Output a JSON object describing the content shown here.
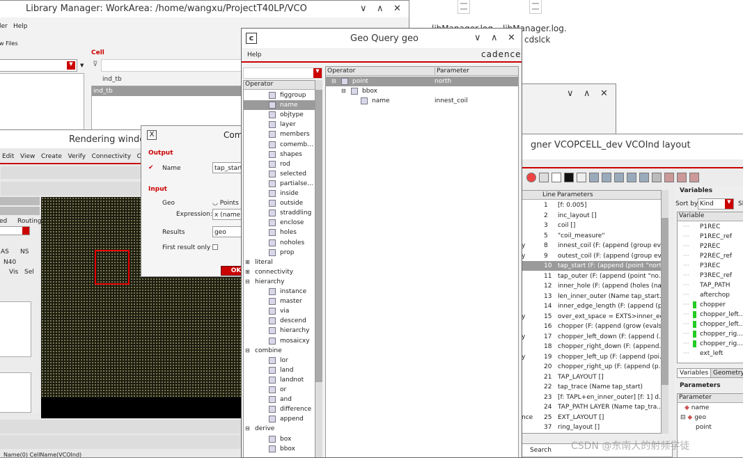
{
  "desktop": {
    "files": [
      {
        "label": "libManager.log"
      },
      {
        "label": "libManager.log."
      },
      {
        "label": "cdslck"
      }
    ]
  },
  "lib_manager": {
    "title": "Library Manager: WorkArea: /home/wangxu/ProjectT40LP/VCO",
    "menu": [
      "ler",
      "Help"
    ],
    "show_files": "w Files",
    "cell_label": "Cell",
    "cell_filter": "ind_tb",
    "cell_items": [
      "ind_tb"
    ]
  },
  "geo_query": {
    "title": "Geo Query geo",
    "menu": "Help",
    "brand": "cadence",
    "operator_header": "Operator",
    "columns": [
      "Operator",
      "Parameter"
    ],
    "operators": [
      {
        "label": "figgroup",
        "indent": 1
      },
      {
        "label": "name",
        "indent": 1,
        "selected": true
      },
      {
        "label": "objtype",
        "indent": 1
      },
      {
        "label": "layer",
        "indent": 1
      },
      {
        "label": "members",
        "indent": 1
      },
      {
        "label": "comemb...",
        "indent": 1
      },
      {
        "label": "shapes",
        "indent": 1
      },
      {
        "label": "rod",
        "indent": 1
      },
      {
        "label": "selected",
        "indent": 1
      },
      {
        "label": "partialse...",
        "indent": 1
      },
      {
        "label": "inside",
        "indent": 1
      },
      {
        "label": "outside",
        "indent": 1
      },
      {
        "label": "straddling",
        "indent": 1
      },
      {
        "label": "enclose",
        "indent": 1
      },
      {
        "label": "holes",
        "indent": 1
      },
      {
        "label": "noholes",
        "indent": 1
      },
      {
        "label": "prop",
        "indent": 1
      },
      {
        "label": "literal",
        "indent": 0,
        "expander": "+"
      },
      {
        "label": "connectivity",
        "indent": 0,
        "expander": "+"
      },
      {
        "label": "hierarchy",
        "indent": 0,
        "expander": "-"
      },
      {
        "label": "instance",
        "indent": 1
      },
      {
        "label": "master",
        "indent": 1
      },
      {
        "label": "via",
        "indent": 1
      },
      {
        "label": "descend",
        "indent": 1
      },
      {
        "label": "hierarchy",
        "indent": 1
      },
      {
        "label": "mosaicxy",
        "indent": 1
      },
      {
        "label": "combine",
        "indent": 0,
        "expander": "-"
      },
      {
        "label": "lor",
        "indent": 1
      },
      {
        "label": "land",
        "indent": 1
      },
      {
        "label": "landnot",
        "indent": 1
      },
      {
        "label": "or",
        "indent": 1
      },
      {
        "label": "and",
        "indent": 1
      },
      {
        "label": "difference",
        "indent": 1
      },
      {
        "label": "append",
        "indent": 1
      },
      {
        "label": "derive",
        "indent": 0,
        "expander": "-"
      },
      {
        "label": "box",
        "indent": 1
      },
      {
        "label": "bbox",
        "indent": 1
      }
    ],
    "query_tree": [
      {
        "op": "point",
        "param": "north",
        "level": 0,
        "selected": true
      },
      {
        "op": "bbox",
        "param": "",
        "level": 1
      },
      {
        "op": "name",
        "param": "innest_coil",
        "level": 2
      }
    ]
  },
  "ghost_window": {
    "title": ""
  },
  "rendering": {
    "title": "Rendering window",
    "menu": [
      "Edit",
      "View",
      "Create",
      "Verify",
      "Connectivity",
      "Opt"
    ],
    "routing": "Routing",
    "ed": "ed",
    "as": "AS",
    "ns": "NS",
    "layer_title": "N40",
    "vis": "Vis",
    "sel": "Sel",
    "status": "Name(0)   CellName(VCOInd)"
  },
  "com_dialog": {
    "title": "Com",
    "output_label": "Output",
    "name_label": "Name",
    "name_value": "tap_start",
    "input_label": "Input",
    "geo_label": "Geo",
    "points_label": "Points",
    "expression_label": "Expression:",
    "expression_value": "x (name",
    "results_label": "Results",
    "results_value": "geo",
    "first_result_label": "First result only",
    "ok_label": "OK"
  },
  "designer": {
    "title": "gner VCOPCELL_dev VCOInd layout",
    "headers": {
      "line": "Line",
      "params": "Parameters"
    },
    "left_marks": [
      "",
      "",
      "",
      "",
      "y",
      "y",
      "",
      "",
      "",
      "",
      "",
      "y",
      "",
      "y",
      "",
      "y",
      "",
      "",
      "",
      "",
      "",
      "nce",
      "",
      "",
      ""
    ],
    "rows": [
      {
        "line": "1",
        "text": "[f: 0.005]"
      },
      {
        "line": "2",
        "text": "inc_layout []"
      },
      {
        "line": "3",
        "text": "coil []"
      },
      {
        "line": "5",
        "text": "\"coil_measure\""
      },
      {
        "line": "8",
        "text": "innest_coil (F: (append (group ev..."
      },
      {
        "line": "9",
        "text": "outest_coil (F: (append (group ev..."
      },
      {
        "line": "10",
        "text": "tap_start (F: (append (point \"nort...",
        "selected": true
      },
      {
        "line": "11",
        "text": "tap_outer (F: (append (point \"no..."
      },
      {
        "line": "12",
        "text": "inner_hole (F: (append (holes (na..."
      },
      {
        "line": "13",
        "text": "len_inner_outer (Name tap_start..."
      },
      {
        "line": "14",
        "text": "inner_edge_length (F: (append (p..."
      },
      {
        "line": "15",
        "text": "over_ext_space = EXTS>inner_ed..."
      },
      {
        "line": "16",
        "text": "chopper (F: (append (grow (evals..."
      },
      {
        "line": "17",
        "text": "chopper_left_down (F: (append (..."
      },
      {
        "line": "18",
        "text": "chopper_right_down (F: (append..."
      },
      {
        "line": "19",
        "text": "chopper_left_up (F: (append (poi..."
      },
      {
        "line": "20",
        "text": "chopper_right_up (F: (append (p..."
      },
      {
        "line": "21",
        "text": "TAP_LAYOUT []"
      },
      {
        "line": "22",
        "text": "tap_trace (Name tap_start)"
      },
      {
        "line": "23",
        "text": "[f: TAPL+en_inner_outer] [f: 1] d..."
      },
      {
        "line": "24",
        "text": "TAP_PATH LAYER (Name tap_tra..."
      },
      {
        "line": "25",
        "text": "EXT_LAYOUT []"
      },
      {
        "line": "37",
        "text": "ring_layout []"
      }
    ],
    "variables": {
      "title": "Variables",
      "sort_label": "Sort by",
      "sort_value": "Kind",
      "sort_extra": "Sl",
      "col": "Variable",
      "items": [
        {
          "name": "P1REC",
          "green": false
        },
        {
          "name": "P1REC_ref",
          "green": false
        },
        {
          "name": "P2REC",
          "green": false
        },
        {
          "name": "P2REC_ref",
          "green": false
        },
        {
          "name": "P3REC",
          "green": false
        },
        {
          "name": "P3REC_ref",
          "green": false
        },
        {
          "name": "TAP_PATH",
          "green": false
        },
        {
          "name": "afterchop",
          "green": false
        },
        {
          "name": "chopper",
          "green": true
        },
        {
          "name": "chopper_left...",
          "green": true
        },
        {
          "name": "chopper_left...",
          "green": true
        },
        {
          "name": "chopper_rig...",
          "green": true
        },
        {
          "name": "chopper_rig...",
          "green": true
        },
        {
          "name": "ext_left",
          "green": false
        }
      ]
    },
    "tabs": [
      "Variables",
      "Geometry"
    ],
    "parameters": {
      "title": "Parameters",
      "col": "Parameter",
      "items": [
        "name",
        "geo",
        "point"
      ]
    },
    "search": "Search"
  },
  "watermark": "CSDN @东南大的射频学徒"
}
